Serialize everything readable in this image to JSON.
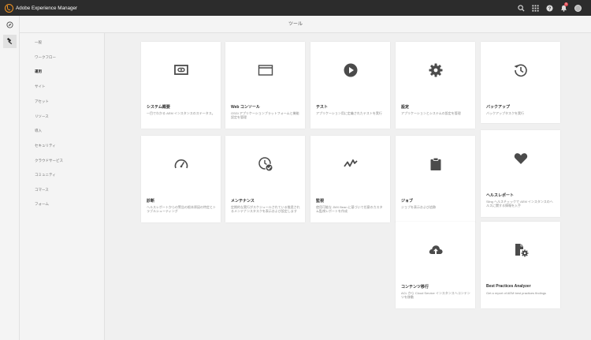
{
  "app": {
    "brand_name": "Adobe Experience Manager",
    "brand_color": "#f29423",
    "notification_count": "5"
  },
  "header": {
    "title": "ツール",
    "icons": [
      "search-icon",
      "apps-grid-icon",
      "help-icon",
      "bell-icon",
      "avatar"
    ]
  },
  "rail": {
    "items": [
      {
        "name": "compass-icon",
        "active": false
      },
      {
        "name": "hammer-icon",
        "active": true
      }
    ]
  },
  "subnav": {
    "items": [
      {
        "label": "一般",
        "active": false
      },
      {
        "label": "ワークフロー",
        "active": false
      },
      {
        "label": "運用",
        "active": true
      },
      {
        "label": "サイト",
        "active": false
      },
      {
        "label": "アセット",
        "active": false
      },
      {
        "label": "リソース",
        "active": false
      },
      {
        "label": "導入",
        "active": false
      },
      {
        "label": "セキュリティ",
        "active": false
      },
      {
        "label": "クラウドサービス",
        "active": false
      },
      {
        "label": "コミュニティ",
        "active": false
      },
      {
        "label": "コマース",
        "active": false
      },
      {
        "label": "フォーム",
        "active": false
      }
    ]
  },
  "cards": [
    {
      "title": "システム概要",
      "desc": "一目でわかる AEM インスタンスのステータス。",
      "icon": "system-overview-icon"
    },
    {
      "title": "Web コンソール",
      "desc": "OSGi アプリケーションプラットフォームと機能設定を管理",
      "icon": "web-console-icon"
    },
    {
      "title": "テスト",
      "desc": "アプリケーション用に定義されたテストを実行",
      "icon": "play-icon"
    },
    {
      "title": "設定",
      "desc": "アプリケーションとシステムの設定を管理",
      "icon": "gear-icon"
    },
    {
      "title": "バックアップ",
      "desc": "バックアップタスクを実行",
      "icon": "history-icon"
    },
    {
      "title": "診断",
      "desc": "ヘルスレポートからの警告の根本原因の特定とトラブルシューティング",
      "icon": "gauge-icon"
    },
    {
      "title": "メンテナンス",
      "desc": "定期的な実行がスケジュールされている推奨されるメンテナンスタスクを表示および設定します",
      "icon": "clock-check-icon"
    },
    {
      "title": "監視",
      "desc": "使用可能な JMX Bean に基づいて任意のカスタム監視レポートを作成",
      "icon": "pulse-icon"
    },
    {
      "title": "ジョブ",
      "desc": "ジョブを表示および追跡",
      "icon": "clipboard-icon"
    },
    {
      "title": "ヘルスレポート",
      "desc": "Sling ヘルスチェックで AEM インスタンスのヘルスに関する情報を入手",
      "icon": "heart-icon"
    },
    {
      "title": "コンテンツ移行",
      "desc": "ACL から Cloud Service インスタンスへコンテンツを移動",
      "icon": "cloud-upload-icon"
    },
    {
      "title": "Best Practices Analyzer",
      "desc": "Get a report of AEM best practices findings",
      "icon": "analyzer-icon"
    }
  ]
}
